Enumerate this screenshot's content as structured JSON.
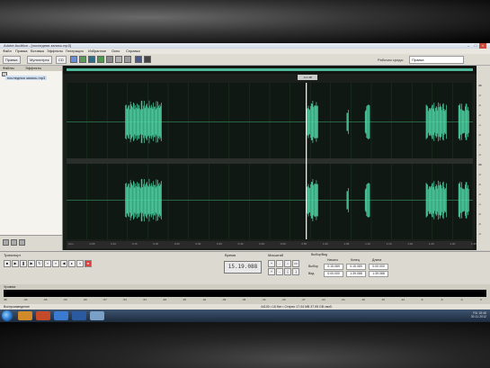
{
  "window": {
    "title": "Adobe Audition - [последняя запись.mp3]"
  },
  "menu": [
    "Файл",
    "Правка",
    "Вставка",
    "Эффекты",
    "Генерация",
    "Избранное",
    "Окно",
    "Справка"
  ],
  "toolbar": {
    "edit_label": "Правка",
    "multitrack_label": "Мультитрек",
    "cd_label": "CD",
    "workspace_label": "Рабочая среда:",
    "workspace_value": "Правка"
  },
  "left_panel": {
    "tabs": [
      "Файлы",
      "Эффекты"
    ],
    "file": "последняя запись.mp3"
  },
  "editor": {
    "cursor_label": "-0.4 dB"
  },
  "timeline_ticks": [
    "hms",
    "0:05",
    "0:10",
    "0:15",
    "0:20",
    "0:25",
    "0:30",
    "0:35",
    "0:40",
    "0:45",
    "0:50",
    "0:55",
    "1:00",
    "1:05",
    "1:10",
    "1:15",
    "1:20",
    "1:25",
    "1:30",
    "1:35"
  ],
  "db_ticks": [
    "dB",
    "-3",
    "-6",
    "-9",
    "-∞",
    "-9",
    "-6",
    "-3",
    "dB",
    "-3",
    "-6",
    "-9",
    "-∞",
    "-9",
    "-6",
    "-3"
  ],
  "transport": {
    "title": "Транспорт",
    "zoom_title": "Масштаб",
    "time_display": "15.19.088",
    "time_title": "Время"
  },
  "selection": {
    "title": "Выбор/Вид",
    "headers": [
      "Начало",
      "Конец",
      "Длина"
    ],
    "row_labels": [
      "Выбор",
      "Вид"
    ],
    "rows": [
      [
        "0:15.089",
        "0:15.089",
        "0:00.000"
      ],
      [
        "0:00.000",
        "1:39.088",
        "1:39.088"
      ]
    ]
  },
  "levels": {
    "title": "Уровни",
    "ticks": [
      "dB",
      "-69",
      "-66",
      "-63",
      "-60",
      "-57",
      "-54",
      "-51",
      "-48",
      "-45",
      "-42",
      "-39",
      "-36",
      "-33",
      "-30",
      "-27",
      "-24",
      "-21",
      "-18",
      "-15",
      "-12",
      "-9",
      "-6",
      "-3",
      "0"
    ]
  },
  "status": {
    "left": "Воспроизведение",
    "right": "44100 • 16 бит • Стерео  17.04 MB  37.95 GB своб."
  },
  "tray": {
    "lang": "RU",
    "time": "18:46",
    "date": "30.11.2012"
  },
  "colors": {
    "waveform": "#4fd6a6",
    "background": "#0f1812",
    "grid": "#1f3a25"
  }
}
